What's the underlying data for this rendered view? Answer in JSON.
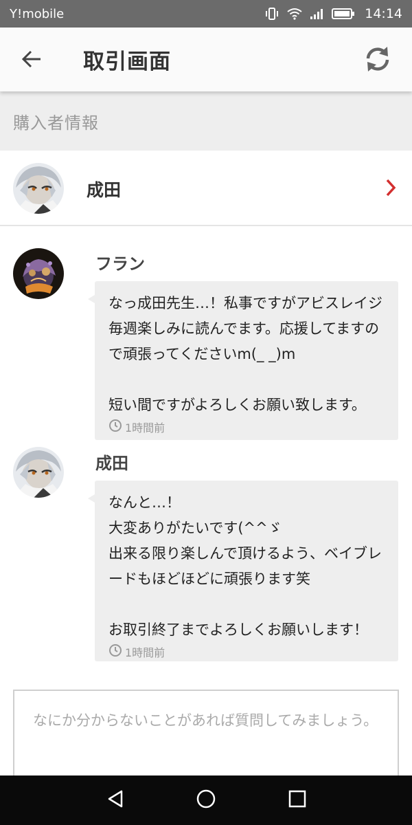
{
  "status_bar": {
    "carrier": "Y!mobile",
    "time": "14:14",
    "icons": [
      "vibrate-icon",
      "wifi-icon",
      "signal-icon",
      "battery-icon"
    ]
  },
  "app_bar": {
    "title": "取引画面",
    "back_icon": "arrow-left-icon",
    "refresh_icon": "refresh-icon"
  },
  "section": {
    "title": "購入者情報"
  },
  "buyer": {
    "name": "成田",
    "chevron_color": "#d32f2f"
  },
  "messages": [
    {
      "author": "フラン",
      "text": "なっ成田先生…！私事ですがアビスレイジ毎週楽しみに読んでます。応援してますので頑張ってくださいm(_ _)m\n\n短い間ですがよろしくお願い致します。",
      "time": "1時間前"
    },
    {
      "author": "成田",
      "text": "なんと…！\n大変ありがたいです(^^ゞ\n出来る限り楽しんで頂けるよう、ベイブレードもほどほどに頑張ります笑\n\nお取引終了までよろしくお願いします！",
      "time": "1時間前"
    }
  ],
  "input": {
    "placeholder": "なにか分からないことがあれば質問してみましょう。",
    "value": ""
  },
  "nav_bar": {
    "icons": [
      "back-triangle-icon",
      "home-circle-icon",
      "recents-square-icon"
    ]
  }
}
